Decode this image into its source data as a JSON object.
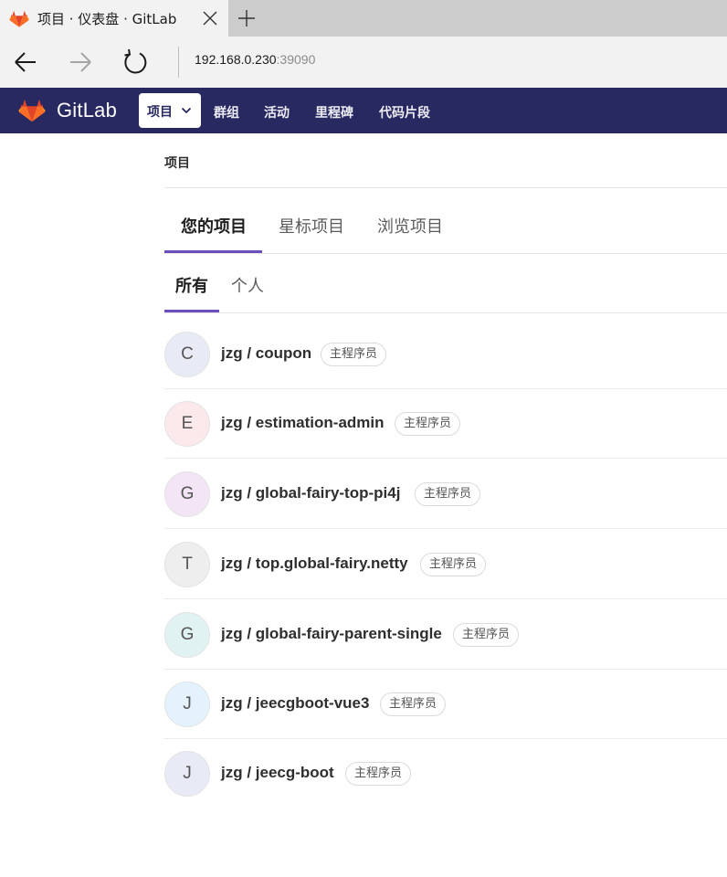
{
  "browser": {
    "tab_title": "项目 · 仪表盘 · GitLab",
    "url_host": "192.168.0.230",
    "url_port": ":39090",
    "icons": {
      "favicon": "gitlab-favicon-icon",
      "close": "close-icon",
      "new_tab": "plus-icon",
      "back": "back-arrow-icon",
      "forward": "forward-arrow-icon",
      "refresh": "refresh-icon"
    }
  },
  "navbar": {
    "brand": "GitLab",
    "projects_label": "项目",
    "links": [
      "群组",
      "活动",
      "里程碑",
      "代码片段"
    ],
    "colors": {
      "background": "#292961",
      "accent": "#6b4fbb"
    }
  },
  "page": {
    "breadcrumb": "项目",
    "top_tabs": [
      "您的项目",
      "星标项目",
      "浏览项目"
    ],
    "sub_tabs": [
      "所有",
      "个人"
    ]
  },
  "projects": [
    {
      "initial": "C",
      "name": "jzg / coupon",
      "role": "主程序员",
      "avatar_color": "#e8eaf6"
    },
    {
      "initial": "E",
      "name": "jzg / estimation-admin",
      "role": "主程序员",
      "avatar_color": "#fbe9eb"
    },
    {
      "initial": "G",
      "name": "jzg / global-fairy-top-pi4j",
      "role": "主程序员",
      "avatar_color": "#f3e5f5"
    },
    {
      "initial": "T",
      "name": "jzg / top.global-fairy.netty",
      "role": "主程序员",
      "avatar_color": "#eeeeee"
    },
    {
      "initial": "G",
      "name": "jzg / global-fairy-parent-single",
      "role": "主程序员",
      "avatar_color": "#e0f2f1"
    },
    {
      "initial": "J",
      "name": "jzg / jeecgboot-vue3",
      "role": "主程序员",
      "avatar_color": "#e3f2fd"
    },
    {
      "initial": "J",
      "name": "jzg / jeecg-boot",
      "role": "主程序员",
      "avatar_color": "#e8eaf6"
    }
  ]
}
